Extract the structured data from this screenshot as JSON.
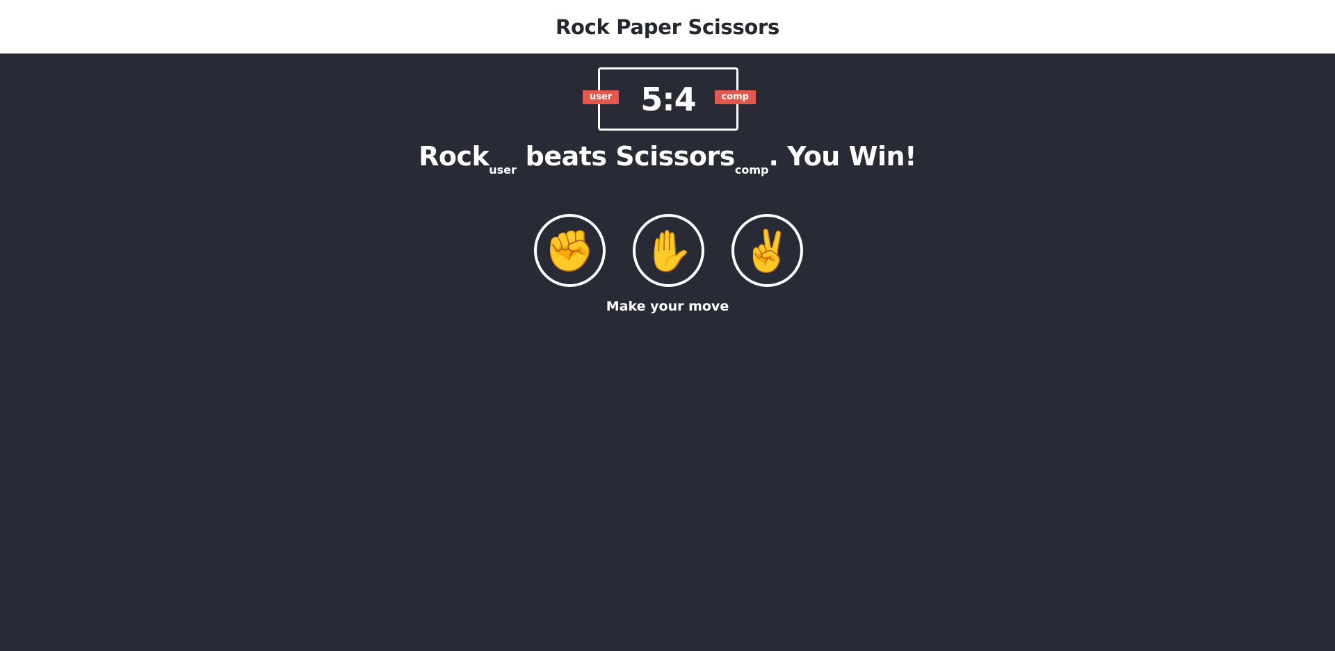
{
  "header": {
    "title": "Rock Paper Scissors"
  },
  "scoreboard": {
    "score": "5:4",
    "user_label": "user",
    "comp_label": "comp"
  },
  "result": {
    "user_choice": "Rock",
    "user_sub": "user",
    "verb": " beats ",
    "comp_choice": "Scissors",
    "comp_sub": "comp",
    "outcome": ". You Win!"
  },
  "choices": [
    {
      "name": "rock",
      "icon": "fist-icon",
      "glyph": "✊"
    },
    {
      "name": "paper",
      "icon": "raised-hand-icon",
      "glyph": "✋"
    },
    {
      "name": "scissors",
      "icon": "victory-hand-icon",
      "glyph": "✌️"
    }
  ],
  "message": "Make your move",
  "colors": {
    "background": "#282b35",
    "header_background": "#ffffff",
    "header_text": "#24272e",
    "badge": "#e2584d",
    "border": "#ffffff"
  }
}
